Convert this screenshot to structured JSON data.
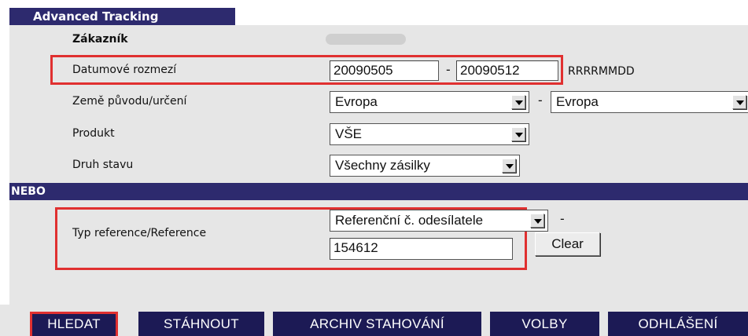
{
  "header": {
    "title": "Advanced Tracking"
  },
  "form": {
    "customer_label": "Zákazník",
    "date_range": {
      "label": "Datumové rozmezí",
      "from": "20090505",
      "separator": "-",
      "to": "20090512",
      "format_hint": "RRRRMMDD"
    },
    "country": {
      "label": "Země původu/určení",
      "origin": "Evropa",
      "separator": "-",
      "destination": "Evropa"
    },
    "product": {
      "label": "Produkt",
      "value": "VŠE"
    },
    "status": {
      "label": "Druh stavu",
      "value": "Všechny zásilky"
    }
  },
  "or_section": {
    "label": "NEBO",
    "reference": {
      "label": "Typ reference/Reference",
      "type": "Referenční č. odesílatele",
      "separator": "-",
      "value": "154612",
      "clear_label": "Clear"
    }
  },
  "nav": {
    "search": "HLEDAT",
    "download": "STÁHNOUT",
    "archive": "ARCHIV STAHOVÁNÍ",
    "options": "VOLBY",
    "logout": "ODHLÁŠENÍ"
  },
  "colors": {
    "header_bg": "#2d2a6e",
    "nav_bg": "#1c1a55",
    "panel_bg": "#e6e6e6",
    "highlight": "#e03030"
  }
}
